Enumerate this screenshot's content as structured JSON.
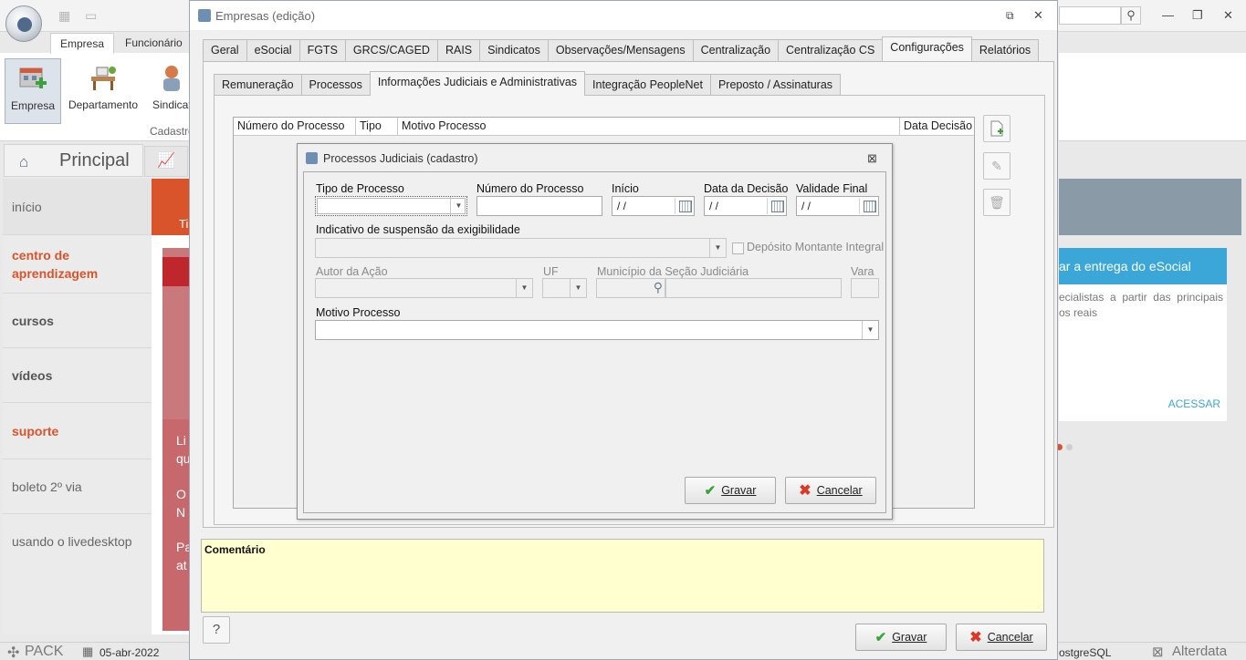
{
  "main_app": {
    "ribbon_tabs": [
      "Empresa",
      "Funcionário"
    ],
    "ribbon_buttons": [
      "Empresa",
      "Departamento",
      "Sindicato"
    ],
    "ribbon_group": "Cadastro",
    "home_tab": "Principal",
    "side_menu": [
      "início",
      "centro de aprendizagem",
      "cursos",
      "vídeos",
      "suporte",
      "boleto 2º via",
      "usando o livedesktop"
    ],
    "strip_text": "Ti",
    "red_panel_texts": [
      "Li",
      "qu",
      "O",
      "N",
      "Pa",
      "at"
    ],
    "right_card": {
      "title": "ar a entrega do eSocial",
      "text": "ecialistas a partir das principais os reais",
      "link": "ACESSAR"
    },
    "bottom": {
      "logo": "PACK",
      "date": "05-abr-2022",
      "db": "ostgreSQL",
      "brand": "Alterdata"
    }
  },
  "window": {
    "title": "Empresas (edição)",
    "tabs": [
      "Geral",
      "eSocial",
      "FGTS",
      "GRCS/CAGED",
      "RAIS",
      "Sindicatos",
      "Observações/Mensagens",
      "Centralização",
      "Centralização CS",
      "Configurações",
      "Relatórios"
    ],
    "active_tab": "Configurações",
    "subtabs": [
      "Remuneração",
      "Processos",
      "Informações Judiciais e Administrativas",
      "Integração PeopleNet",
      "Preposto / Assinaturas"
    ],
    "active_subtab": "Informações Judiciais e Administrativas",
    "grid_columns": [
      "Número do Processo",
      "Tipo",
      "Motivo Processo",
      "Data Decisão"
    ],
    "comment_label": "Comentário",
    "help_label": "?",
    "save_label": "Gravar",
    "cancel_label": "Cancelar"
  },
  "dialog": {
    "title": "Processos Judiciais (cadastro)",
    "fields": {
      "tipo_processo": {
        "label": "Tipo de Processo",
        "value": ""
      },
      "numero_processo": {
        "label": "Número do Processo",
        "value": ""
      },
      "inicio": {
        "label": "Início",
        "value": "/ /"
      },
      "data_decisao": {
        "label": "Data da Decisão",
        "value": "/ /"
      },
      "validade_final": {
        "label": "Validade Final",
        "value": "/ /"
      },
      "indicativo": {
        "label": "Indicativo de suspensão da exigibilidade",
        "value": ""
      },
      "deposito": {
        "label": "Depósito Montante Integral",
        "checked": false
      },
      "autor": {
        "label": "Autor da Ação",
        "value": ""
      },
      "uf": {
        "label": "UF",
        "value": ""
      },
      "municipio": {
        "label": "Município da Seção Judiciária",
        "value": ""
      },
      "vara": {
        "label": "Vara",
        "value": ""
      },
      "motivo": {
        "label": "Motivo Processo",
        "value": ""
      }
    },
    "save_label": "Gravar",
    "cancel_label": "Cancelar"
  }
}
